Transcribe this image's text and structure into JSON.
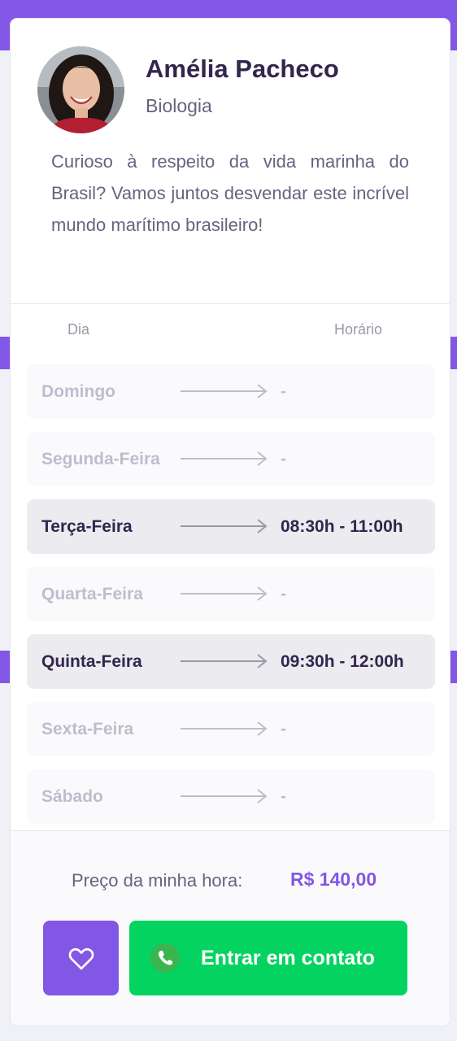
{
  "teacher": {
    "name": "Amélia Pacheco",
    "subject": "Biologia",
    "bio": "Curioso à respeito da vida marinha do Brasil? Vamos juntos desvendar este incrível mundo marítimo brasileiro!"
  },
  "schedule": {
    "day_header": "Dia",
    "time_header": "Horário",
    "rows": [
      {
        "day": "Domingo",
        "time": "-",
        "active": false
      },
      {
        "day": "Segunda-Feira",
        "time": "-",
        "active": false
      },
      {
        "day": "Terça-Feira",
        "time": "08:30h - 11:00h",
        "active": true
      },
      {
        "day": "Quarta-Feira",
        "time": "-",
        "active": false
      },
      {
        "day": "Quinta-Feira",
        "time": "09:30h - 12:00h",
        "active": true
      },
      {
        "day": "Sexta-Feira",
        "time": "-",
        "active": false
      },
      {
        "day": "Sábado",
        "time": "-",
        "active": false
      }
    ]
  },
  "footer": {
    "price_label": "Preço da minha hora:",
    "price_value": "R$ 140,00",
    "favorite_icon": "heart-icon",
    "contact_icon": "whatsapp-icon",
    "contact_label": "Entrar em contato"
  },
  "colors": {
    "primary": "#8257E5",
    "secondary": "#04D361",
    "title": "#32264D",
    "text": "#6A6180",
    "muted": "#C1BCCC"
  }
}
